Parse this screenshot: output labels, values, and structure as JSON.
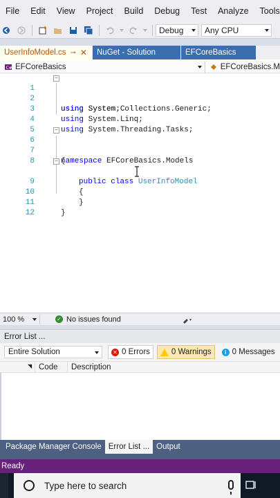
{
  "menu": [
    "File",
    "Edit",
    "View",
    "Project",
    "Build",
    "Debug",
    "Test",
    "Analyze",
    "Tools"
  ],
  "toolbar": {
    "configuration": "Debug",
    "platform": "Any CPU"
  },
  "tabs": {
    "active": "UserInfoModel.cs",
    "active_pin": "⊸",
    "active_close": "✕",
    "second": "NuGet - Solution",
    "third": "EFCoreBasics"
  },
  "navbar": {
    "project": "EFCoreBasics",
    "member": "EFCoreBasics.M"
  },
  "editor": {
    "line_numbers": [
      "1",
      "2",
      "3",
      "4",
      "5",
      "6",
      "7",
      "8",
      "9",
      "10",
      "11",
      "12"
    ],
    "usings": [
      "System;",
      "System.Collections.Generic;",
      "System.Linq;",
      "System.Threading.Tasks;"
    ],
    "using_kw": "using",
    "namespace_kw": "namespace",
    "namespace_name": "EFCoreBasics.Models",
    "public_kw": "public",
    "class_kw": "class",
    "class_name": "UserInfoModel",
    "open_brace": "{",
    "close_brace": "}"
  },
  "status": {
    "zoom": "100 %",
    "issues": "No issues found"
  },
  "error_list": {
    "title": "Error List ...",
    "scope": "Entire Solution",
    "errors": "0 Errors",
    "warnings": "0 Warnings",
    "messages": "0 Messages",
    "col_code": "Code",
    "col_desc": "Description"
  },
  "bottom_tabs": [
    "Package Manager Console",
    "Error List ...",
    "Output"
  ],
  "statusbar": {
    "text": "Ready"
  },
  "taskbar": {
    "search_placeholder": "Type here to search"
  },
  "colors": {
    "accent": "#68217a",
    "keyword": "#0000ff",
    "type": "#2b91af",
    "tab_blue": "#3b6db3"
  }
}
